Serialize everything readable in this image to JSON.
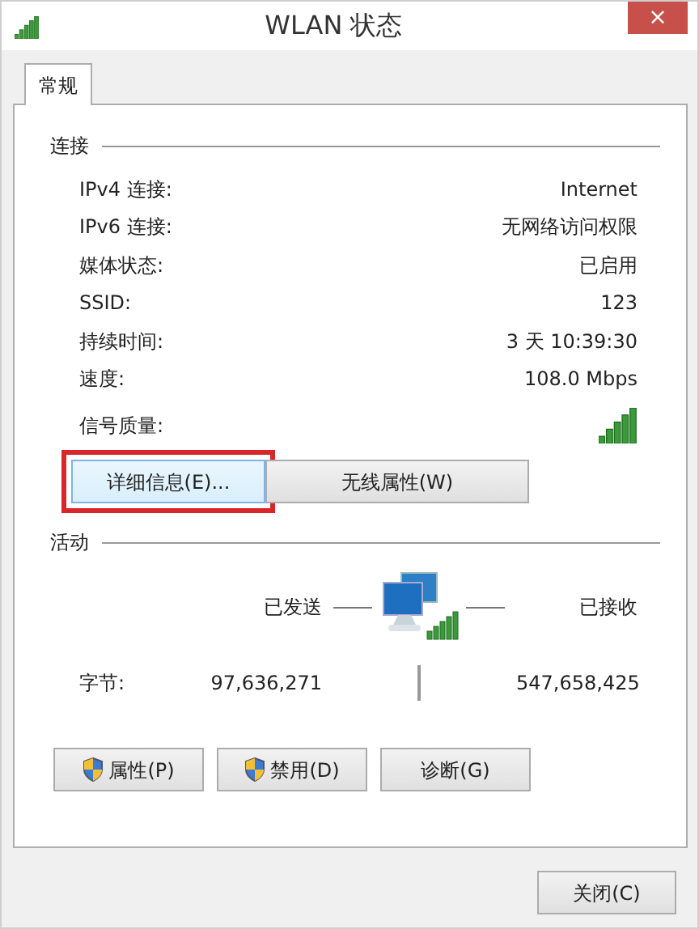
{
  "window": {
    "title": "WLAN 状态",
    "close": "×"
  },
  "tabs": [
    {
      "label": "常规",
      "selected": true
    }
  ],
  "connection": {
    "heading": "连接",
    "rows": [
      {
        "label": "IPv4 连接:",
        "value": "Internet",
        "kind": "text"
      },
      {
        "label": "IPv6 连接:",
        "value": "无网络访问权限",
        "kind": "text"
      },
      {
        "label": "媒体状态:",
        "value": "已启用",
        "kind": "text"
      },
      {
        "label": "SSID:",
        "value": "123",
        "kind": "text"
      },
      {
        "label": "持续时间:",
        "value": "3 天 10:39:30",
        "kind": "text"
      },
      {
        "label": "速度:",
        "value": "108.0 Mbps",
        "kind": "text"
      },
      {
        "label": "信号质量:",
        "kind": "signal"
      }
    ],
    "buttons": [
      {
        "label": "详细信息(E)...",
        "highlighted": true
      },
      {
        "label": "无线属性(W)",
        "highlighted": false
      }
    ]
  },
  "activity": {
    "heading": "活动",
    "sent_label": "已发送",
    "received_label": "已接收",
    "bytes_label": "字节:",
    "sent": "97,636,271",
    "received": "547,658,425"
  },
  "buttons": [
    {
      "label": "属性(P)",
      "shield": true
    },
    {
      "label": "禁用(D)",
      "shield": true
    },
    {
      "label": "诊断(G)",
      "shield": false
    }
  ],
  "footer_button": "关闭(C)"
}
